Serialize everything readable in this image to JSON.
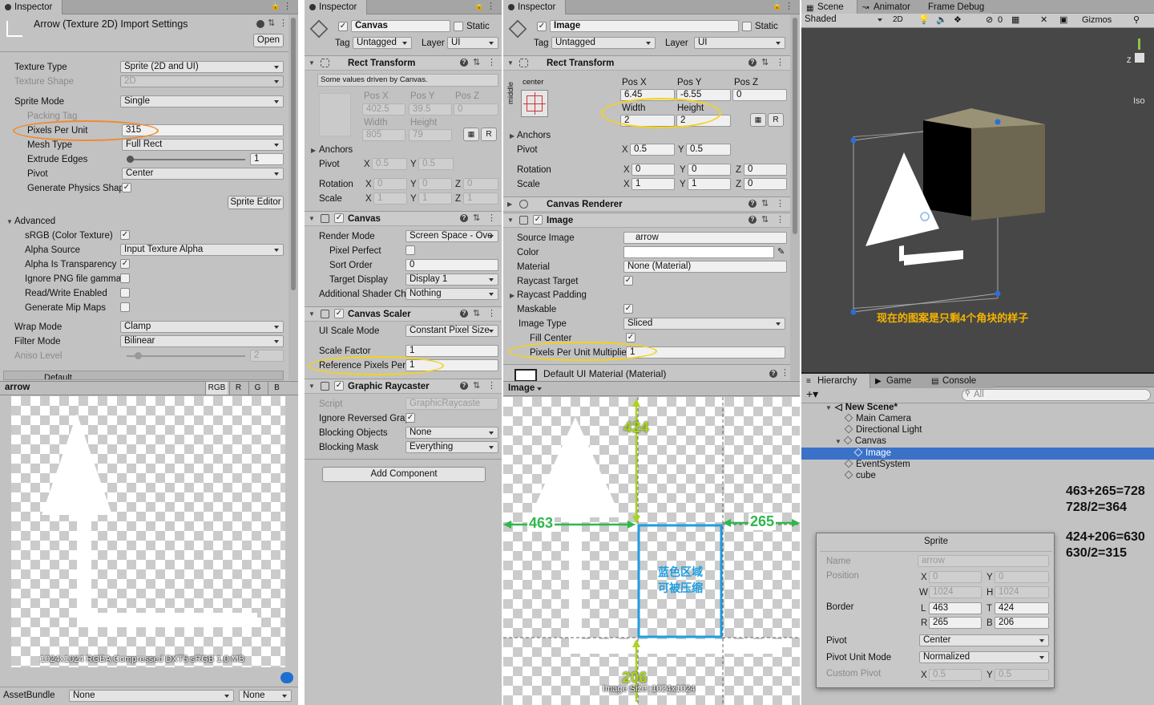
{
  "panel1": {
    "tab": "Inspector",
    "title": "Arrow (Texture 2D) Import Settings",
    "open_button": "Open",
    "rows": [
      {
        "label": "Texture Type",
        "value": "Sprite (2D and UI)"
      },
      {
        "label": "Texture Shape",
        "value": "2D"
      },
      {
        "label": "Sprite Mode",
        "value": "Single"
      },
      {
        "label": "Packing Tag",
        "value": ""
      },
      {
        "label": "Pixels Per Unit",
        "value": "315"
      },
      {
        "label": "Mesh Type",
        "value": "Full Rect"
      },
      {
        "label": "Extrude Edges",
        "value": "1"
      },
      {
        "label": "Pivot",
        "value": "Center"
      },
      {
        "label": "Generate Physics Shap",
        "value": "checked"
      }
    ],
    "sprite_editor_button": "Sprite Editor",
    "advanced_label": "Advanced",
    "advanced_rows": [
      {
        "label": "sRGB (Color Texture)",
        "checked": true
      },
      {
        "label": "Alpha Source",
        "value": "Input Texture Alpha"
      },
      {
        "label": "Alpha Is Transparency",
        "checked": true
      },
      {
        "label": "Ignore PNG file gamma",
        "checked": false
      },
      {
        "label": "Read/Write Enabled",
        "checked": false
      },
      {
        "label": "Generate Mip Maps",
        "checked": false
      }
    ],
    "wrap_mode": {
      "label": "Wrap Mode",
      "value": "Clamp"
    },
    "filter_mode": {
      "label": "Filter Mode",
      "value": "Bilinear"
    },
    "aniso": {
      "label": "Aniso Level",
      "value": "2"
    },
    "default_tab": "Default",
    "preview_name": "arrow",
    "channels": [
      "RGB",
      "R",
      "G",
      "B"
    ],
    "preview_info": "1024x1024  RGBA Compressed DXT5 sRGB  1.0 MB",
    "assetbundle_label": "AssetBundle",
    "assetbundle_value": "None",
    "assetbundle_variant": "None"
  },
  "panel2": {
    "tab": "Inspector",
    "object_name": "Canvas",
    "static_label": "Static",
    "tag_label": "Tag",
    "tag_value": "Untagged",
    "layer_label": "Layer",
    "layer_value": "UI",
    "rect_transform": "Rect Transform",
    "driven_note": "Some values driven by Canvas.",
    "pos_headers": [
      "Pos X",
      "Pos Y",
      "Pos Z"
    ],
    "pos_values": [
      "402.5",
      "39.5",
      "0"
    ],
    "size_headers": [
      "Width",
      "Height"
    ],
    "size_values": [
      "805",
      "79"
    ],
    "r_button": "R",
    "anchors": "Anchors",
    "pivot": {
      "label": "Pivot",
      "x": "0.5",
      "y": "0.5"
    },
    "rotation": {
      "label": "Rotation",
      "x": "0",
      "y": "0",
      "z": "0"
    },
    "scale": {
      "label": "Scale",
      "x": "1",
      "y": "1",
      "z": "1"
    },
    "canvas": {
      "title": "Canvas",
      "render_mode": {
        "label": "Render Mode",
        "value": "Screen Space - Ove"
      },
      "pixel_perfect": "Pixel Perfect",
      "sort_order": {
        "label": "Sort Order",
        "value": "0"
      },
      "target_display": {
        "label": "Target Display",
        "value": "Display 1"
      },
      "shader_channels": {
        "label": "Additional Shader Ch",
        "value": "Nothing"
      }
    },
    "scaler": {
      "title": "Canvas Scaler",
      "ui_scale_mode": {
        "label": "UI Scale Mode",
        "value": "Constant Pixel Size"
      },
      "scale_factor": {
        "label": "Scale Factor",
        "value": "1"
      },
      "ref_ppu": {
        "label": "Reference Pixels Per",
        "value": "1"
      }
    },
    "raycaster": {
      "title": "Graphic Raycaster",
      "script": {
        "label": "Script",
        "value": "GraphicRaycaste"
      },
      "ignore_reversed": "Ignore Reversed Grap",
      "blocking_objects": {
        "label": "Blocking Objects",
        "value": "None"
      },
      "blocking_mask": {
        "label": "Blocking Mask",
        "value": "Everything"
      }
    },
    "add_component": "Add Component"
  },
  "panel3": {
    "tab": "Inspector",
    "object_name": "Image",
    "static_label": "Static",
    "tag_label": "Tag",
    "tag_value": "Untagged",
    "layer_label": "Layer",
    "layer_value": "UI",
    "rect_transform": "Rect Transform",
    "anchor_h": "center",
    "anchor_v": "middle",
    "pos_headers": [
      "Pos X",
      "Pos Y",
      "Pos Z"
    ],
    "pos_values": [
      "6.45",
      "-6.55",
      "0"
    ],
    "size_headers": [
      "Width",
      "Height"
    ],
    "size_values": [
      "2",
      "2"
    ],
    "r_button": "R",
    "anchors": "Anchors",
    "pivot": {
      "label": "Pivot",
      "x": "0.5",
      "y": "0.5"
    },
    "rotation": {
      "label": "Rotation",
      "x": "0",
      "y": "0",
      "z": "0"
    },
    "scale": {
      "label": "Scale",
      "x": "1",
      "y": "1",
      "z": "0"
    },
    "canvas_renderer": "Canvas Renderer",
    "image": {
      "title": "Image",
      "source_image": {
        "label": "Source Image",
        "value": "arrow"
      },
      "color_label": "Color",
      "material": {
        "label": "Material",
        "value": "None (Material)"
      },
      "raycast_target": "Raycast Target",
      "raycast_padding": "Raycast Padding",
      "maskable": "Maskable",
      "image_type": {
        "label": "Image Type",
        "value": "Sliced"
      },
      "fill_center": "Fill Center",
      "ppu_multiplier": {
        "label": "Pixels Per Unit Multiplie",
        "value": "1"
      }
    },
    "default_material": "Default UI Material (Material)",
    "preview_dropdown": "Image",
    "preview_info": "Image Size: 1024x1024",
    "anno_top": "424",
    "anno_left": "463",
    "anno_right": "265",
    "anno_bottom": "206",
    "anno_center": "蓝色区域\n可被压缩"
  },
  "scene": {
    "tabs": [
      "Scene",
      "Animator",
      "Frame Debug"
    ],
    "shaded": "Shaded",
    "mode_2d": "2D",
    "gizmo_count": "0",
    "gizmos": "Gizmos",
    "iso": "Iso",
    "note": "现在的图案是只剩4个角块的样子"
  },
  "hierarchy": {
    "tabs": [
      "Hierarchy",
      "Game",
      "Console"
    ],
    "search_placeholder": "All",
    "items": [
      {
        "name": "New Scene*",
        "depth": 0
      },
      {
        "name": "Main Camera",
        "depth": 1
      },
      {
        "name": "Directional Light",
        "depth": 1
      },
      {
        "name": "Canvas",
        "depth": 1
      },
      {
        "name": "Image",
        "depth": 2
      },
      {
        "name": "EventSystem",
        "depth": 1
      },
      {
        "name": "cube",
        "depth": 1
      }
    ],
    "math": [
      "463+265=728",
      "728/2=364",
      "424+206=630",
      "630/2=315"
    ]
  },
  "sprite_popup": {
    "title": "Sprite",
    "name_label": "Name",
    "name_value": "arrow",
    "position_label": "Position",
    "x_value": "0",
    "y_value": "0",
    "w_value": "1024",
    "h_value": "1024",
    "border_label": "Border",
    "l_value": "463",
    "t_value": "424",
    "r_value": "265",
    "b_value": "206",
    "pivot_label": "Pivot",
    "pivot_value": "Center",
    "pivot_unit_label": "Pivot Unit Mode",
    "pivot_unit_value": "Normalized",
    "custom_pivot_label": "Custom Pivot",
    "cp_x": "0.5",
    "cp_y": "0.5"
  },
  "colors": {
    "orange": "#f08a2e",
    "yellow": "#f5d21a",
    "green": "#2eb84b",
    "blue": "#1e9ee0",
    "selection": "#3a72c9"
  }
}
